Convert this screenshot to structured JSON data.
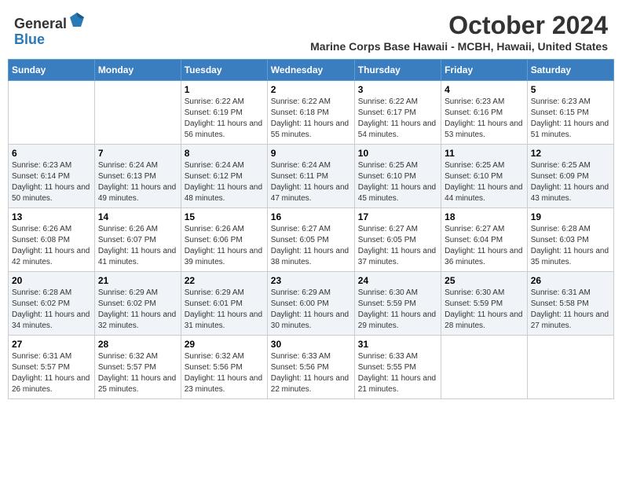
{
  "logo": {
    "general": "General",
    "blue": "Blue"
  },
  "title": "October 2024",
  "subtitle": "Marine Corps Base Hawaii - MCBH, Hawaii, United States",
  "weekdays": [
    "Sunday",
    "Monday",
    "Tuesday",
    "Wednesday",
    "Thursday",
    "Friday",
    "Saturday"
  ],
  "weeks": [
    [
      null,
      null,
      {
        "day": "1",
        "sunrise": "Sunrise: 6:22 AM",
        "sunset": "Sunset: 6:19 PM",
        "daylight": "Daylight: 11 hours and 56 minutes."
      },
      {
        "day": "2",
        "sunrise": "Sunrise: 6:22 AM",
        "sunset": "Sunset: 6:18 PM",
        "daylight": "Daylight: 11 hours and 55 minutes."
      },
      {
        "day": "3",
        "sunrise": "Sunrise: 6:22 AM",
        "sunset": "Sunset: 6:17 PM",
        "daylight": "Daylight: 11 hours and 54 minutes."
      },
      {
        "day": "4",
        "sunrise": "Sunrise: 6:23 AM",
        "sunset": "Sunset: 6:16 PM",
        "daylight": "Daylight: 11 hours and 53 minutes."
      },
      {
        "day": "5",
        "sunrise": "Sunrise: 6:23 AM",
        "sunset": "Sunset: 6:15 PM",
        "daylight": "Daylight: 11 hours and 51 minutes."
      }
    ],
    [
      {
        "day": "6",
        "sunrise": "Sunrise: 6:23 AM",
        "sunset": "Sunset: 6:14 PM",
        "daylight": "Daylight: 11 hours and 50 minutes."
      },
      {
        "day": "7",
        "sunrise": "Sunrise: 6:24 AM",
        "sunset": "Sunset: 6:13 PM",
        "daylight": "Daylight: 11 hours and 49 minutes."
      },
      {
        "day": "8",
        "sunrise": "Sunrise: 6:24 AM",
        "sunset": "Sunset: 6:12 PM",
        "daylight": "Daylight: 11 hours and 48 minutes."
      },
      {
        "day": "9",
        "sunrise": "Sunrise: 6:24 AM",
        "sunset": "Sunset: 6:11 PM",
        "daylight": "Daylight: 11 hours and 47 minutes."
      },
      {
        "day": "10",
        "sunrise": "Sunrise: 6:25 AM",
        "sunset": "Sunset: 6:10 PM",
        "daylight": "Daylight: 11 hours and 45 minutes."
      },
      {
        "day": "11",
        "sunrise": "Sunrise: 6:25 AM",
        "sunset": "Sunset: 6:10 PM",
        "daylight": "Daylight: 11 hours and 44 minutes."
      },
      {
        "day": "12",
        "sunrise": "Sunrise: 6:25 AM",
        "sunset": "Sunset: 6:09 PM",
        "daylight": "Daylight: 11 hours and 43 minutes."
      }
    ],
    [
      {
        "day": "13",
        "sunrise": "Sunrise: 6:26 AM",
        "sunset": "Sunset: 6:08 PM",
        "daylight": "Daylight: 11 hours and 42 minutes."
      },
      {
        "day": "14",
        "sunrise": "Sunrise: 6:26 AM",
        "sunset": "Sunset: 6:07 PM",
        "daylight": "Daylight: 11 hours and 41 minutes."
      },
      {
        "day": "15",
        "sunrise": "Sunrise: 6:26 AM",
        "sunset": "Sunset: 6:06 PM",
        "daylight": "Daylight: 11 hours and 39 minutes."
      },
      {
        "day": "16",
        "sunrise": "Sunrise: 6:27 AM",
        "sunset": "Sunset: 6:05 PM",
        "daylight": "Daylight: 11 hours and 38 minutes."
      },
      {
        "day": "17",
        "sunrise": "Sunrise: 6:27 AM",
        "sunset": "Sunset: 6:05 PM",
        "daylight": "Daylight: 11 hours and 37 minutes."
      },
      {
        "day": "18",
        "sunrise": "Sunrise: 6:27 AM",
        "sunset": "Sunset: 6:04 PM",
        "daylight": "Daylight: 11 hours and 36 minutes."
      },
      {
        "day": "19",
        "sunrise": "Sunrise: 6:28 AM",
        "sunset": "Sunset: 6:03 PM",
        "daylight": "Daylight: 11 hours and 35 minutes."
      }
    ],
    [
      {
        "day": "20",
        "sunrise": "Sunrise: 6:28 AM",
        "sunset": "Sunset: 6:02 PM",
        "daylight": "Daylight: 11 hours and 34 minutes."
      },
      {
        "day": "21",
        "sunrise": "Sunrise: 6:29 AM",
        "sunset": "Sunset: 6:02 PM",
        "daylight": "Daylight: 11 hours and 32 minutes."
      },
      {
        "day": "22",
        "sunrise": "Sunrise: 6:29 AM",
        "sunset": "Sunset: 6:01 PM",
        "daylight": "Daylight: 11 hours and 31 minutes."
      },
      {
        "day": "23",
        "sunrise": "Sunrise: 6:29 AM",
        "sunset": "Sunset: 6:00 PM",
        "daylight": "Daylight: 11 hours and 30 minutes."
      },
      {
        "day": "24",
        "sunrise": "Sunrise: 6:30 AM",
        "sunset": "Sunset: 5:59 PM",
        "daylight": "Daylight: 11 hours and 29 minutes."
      },
      {
        "day": "25",
        "sunrise": "Sunrise: 6:30 AM",
        "sunset": "Sunset: 5:59 PM",
        "daylight": "Daylight: 11 hours and 28 minutes."
      },
      {
        "day": "26",
        "sunrise": "Sunrise: 6:31 AM",
        "sunset": "Sunset: 5:58 PM",
        "daylight": "Daylight: 11 hours and 27 minutes."
      }
    ],
    [
      {
        "day": "27",
        "sunrise": "Sunrise: 6:31 AM",
        "sunset": "Sunset: 5:57 PM",
        "daylight": "Daylight: 11 hours and 26 minutes."
      },
      {
        "day": "28",
        "sunrise": "Sunrise: 6:32 AM",
        "sunset": "Sunset: 5:57 PM",
        "daylight": "Daylight: 11 hours and 25 minutes."
      },
      {
        "day": "29",
        "sunrise": "Sunrise: 6:32 AM",
        "sunset": "Sunset: 5:56 PM",
        "daylight": "Daylight: 11 hours and 23 minutes."
      },
      {
        "day": "30",
        "sunrise": "Sunrise: 6:33 AM",
        "sunset": "Sunset: 5:56 PM",
        "daylight": "Daylight: 11 hours and 22 minutes."
      },
      {
        "day": "31",
        "sunrise": "Sunrise: 6:33 AM",
        "sunset": "Sunset: 5:55 PM",
        "daylight": "Daylight: 11 hours and 21 minutes."
      },
      null,
      null
    ]
  ]
}
